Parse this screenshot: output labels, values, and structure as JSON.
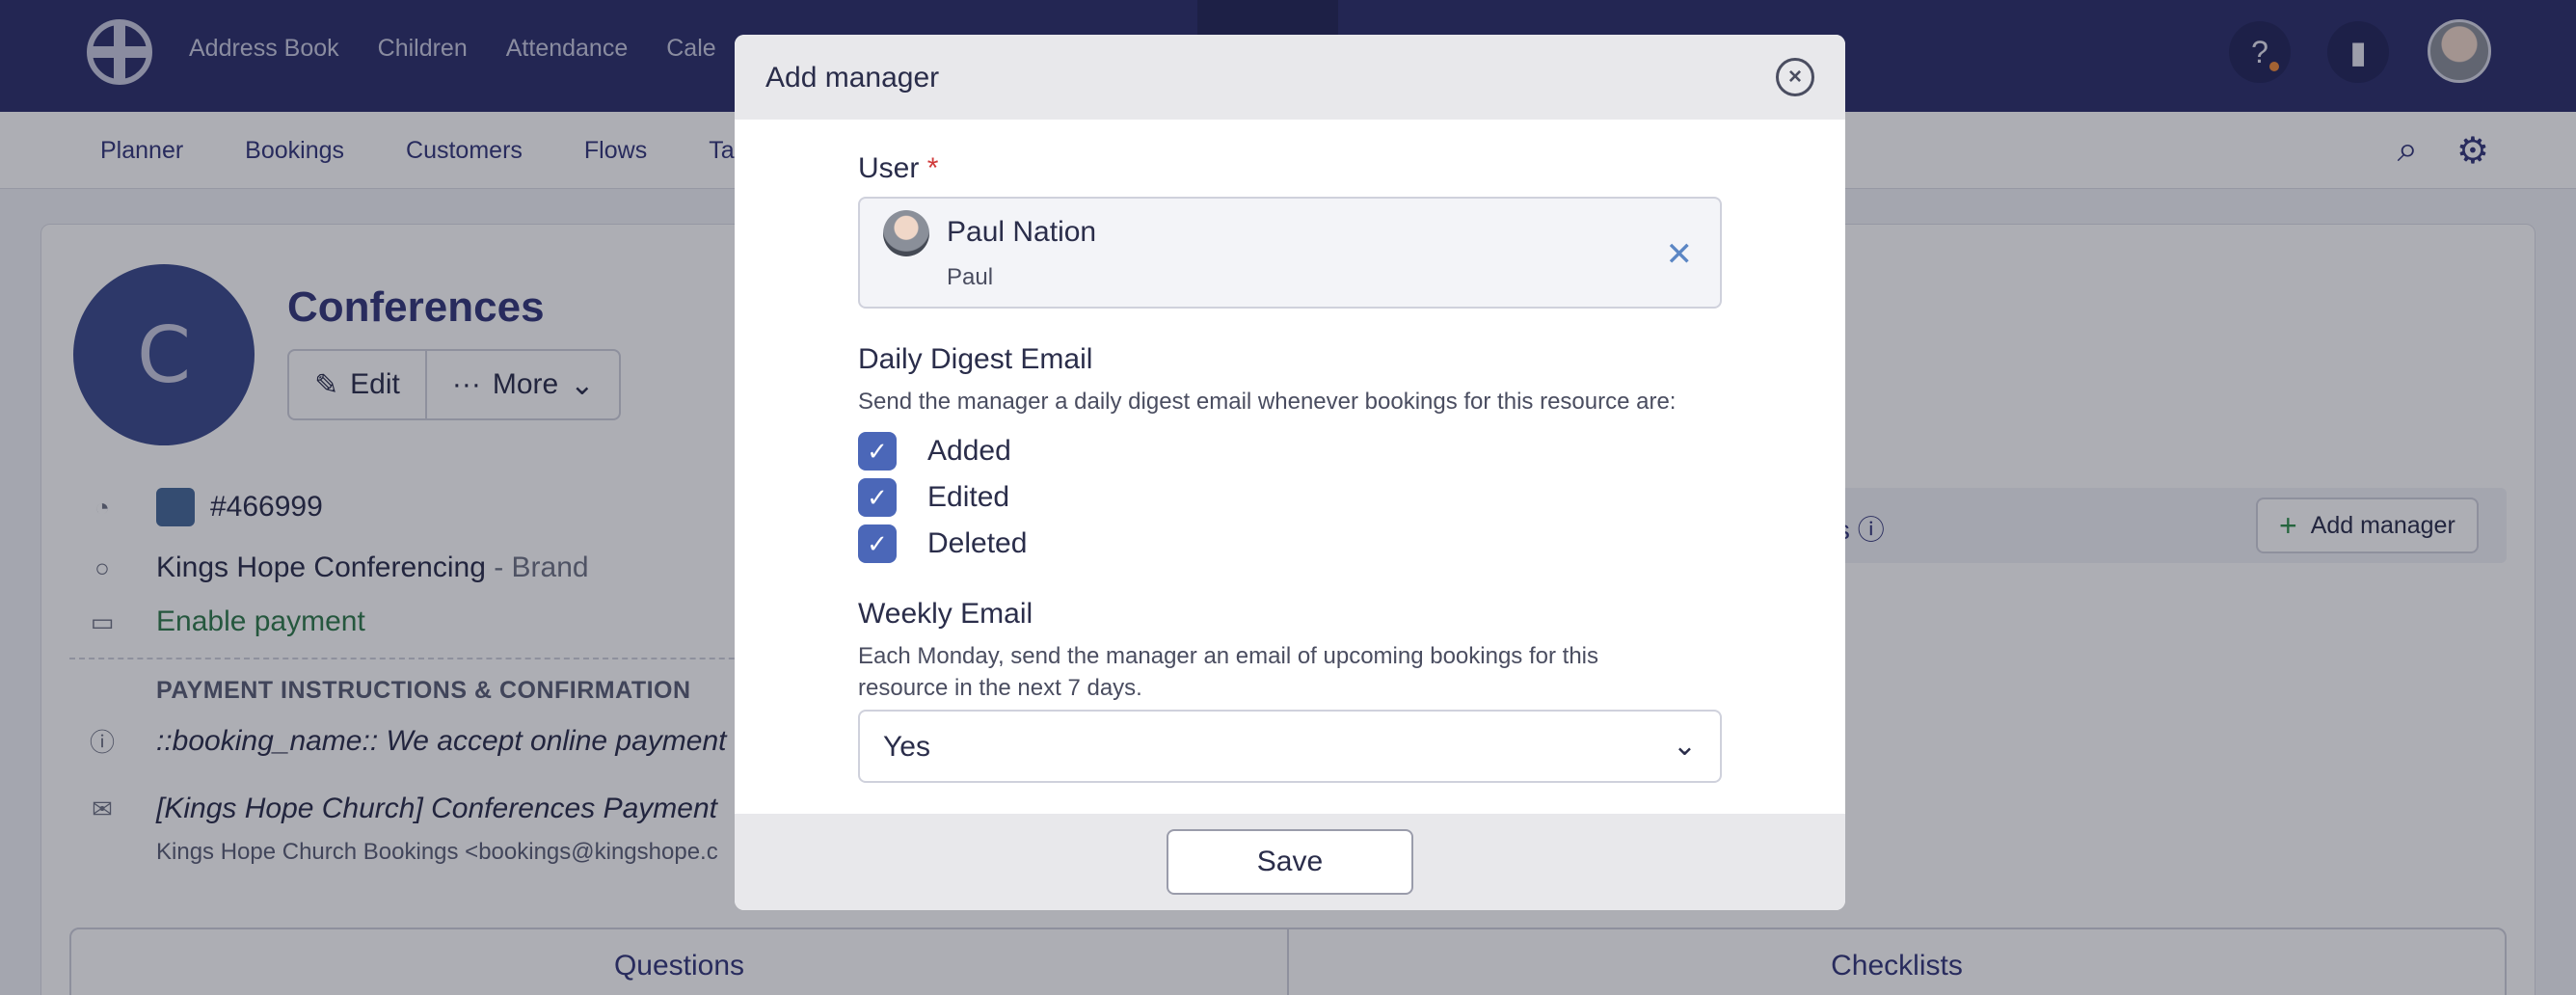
{
  "topnav": {
    "items": [
      "Address Book",
      "Children",
      "Attendance",
      "Cale"
    ],
    "help_icon": "help-icon",
    "building_icon": "building-icon"
  },
  "subnav": {
    "items": [
      "Planner",
      "Bookings",
      "Customers",
      "Flows",
      "Ta"
    ],
    "search_icon": "search-icon",
    "settings_icon": "gear-icon"
  },
  "resource": {
    "avatar_letter": "C",
    "title": "Conferences",
    "edit_label": "Edit",
    "more_label": "More",
    "color_hex": "#466999",
    "brand_name": "Kings Hope Conferencing",
    "brand_suffix": " - Brand",
    "enable_payment": "Enable payment",
    "payment_section": "PAYMENT INSTRUCTIONS & CONFIRMATION",
    "payment_text": "::booking_name:: We accept online payment by c",
    "email_subject": "[Kings Hope Church] Conferences Payment",
    "email_from": "Kings Hope Church Bookings   <bookings@kingshope.c",
    "managers_label": "ers",
    "add_manager_label": "Add manager",
    "tabs": [
      "Questions",
      "Checklists"
    ]
  },
  "modal": {
    "title": "Add manager",
    "user_label": "User",
    "user_required": "*",
    "user_name": "Paul Nation",
    "user_sub": "Paul",
    "digest_label": "Daily Digest Email",
    "digest_desc": "Send the manager a daily digest email whenever bookings for this resource are:",
    "checkboxes": [
      {
        "label": "Added",
        "checked": true
      },
      {
        "label": "Edited",
        "checked": true
      },
      {
        "label": "Deleted",
        "checked": true
      }
    ],
    "weekly_label": "Weekly Email",
    "weekly_desc": "Each Monday, send the manager an email of upcoming bookings for this resource in the next 7 days.",
    "weekly_value": "Yes",
    "save_label": "Save"
  },
  "colors": {
    "nav_bg": "#2b2f6b",
    "accent": "#4b67b8",
    "brand_swatch": "#466999"
  }
}
